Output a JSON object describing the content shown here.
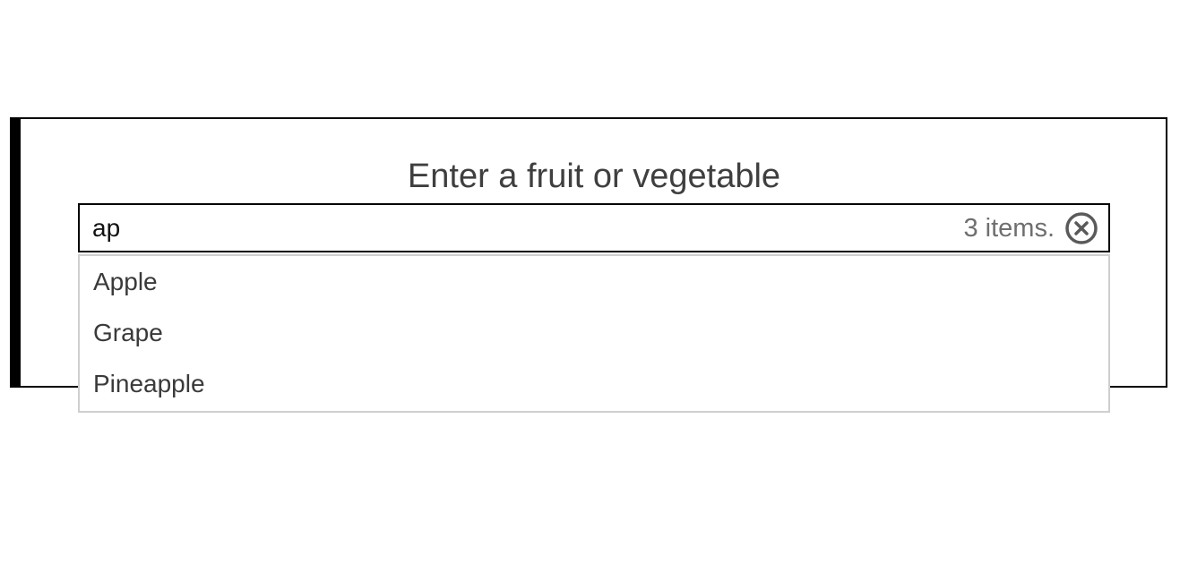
{
  "label": "Enter a fruit or vegetable",
  "input": {
    "value": "ap"
  },
  "status": "3 items.",
  "clear_icon": "close-circle-icon",
  "options": [
    {
      "label": "Apple"
    },
    {
      "label": "Grape"
    },
    {
      "label": "Pineapple"
    }
  ],
  "colors": {
    "border": "#000000",
    "listbox_border": "#cfcfcf",
    "label_text": "#3f3f3f",
    "status_text": "#6f6f6f",
    "icon": "#5a5a5a"
  }
}
